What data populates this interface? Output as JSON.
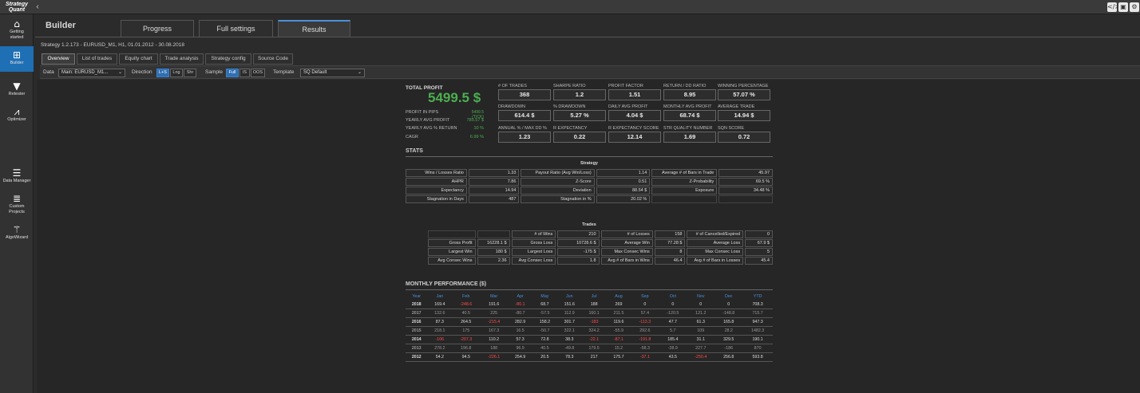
{
  "app": {
    "logo_line1": "Strategy",
    "logo_line2": "Quant",
    "collapse_icon": "chevron-left-icon"
  },
  "top_icons": [
    "code-icon",
    "window-icon",
    "settings-icon"
  ],
  "sidebar": {
    "items": [
      {
        "label1": "Getting",
        "label2": "started",
        "icon": "home-icon"
      },
      {
        "label1": "Builder",
        "label2": "",
        "icon": "plus-box-icon"
      },
      {
        "label1": "Retester",
        "label2": "",
        "icon": "filter-icon"
      },
      {
        "label1": "Optimizer",
        "label2": "",
        "icon": "chart-icon"
      },
      {
        "label1": "Data Manager",
        "label2": "",
        "icon": "database-icon"
      },
      {
        "label1": "Custom",
        "label2": "Projects",
        "icon": "layers-icon"
      },
      {
        "label1": "AlgoWizard",
        "label2": "",
        "icon": "wand-icon"
      }
    ]
  },
  "header": {
    "title": "Builder",
    "tabs": [
      "Progress",
      "Full settings",
      "Results"
    ]
  },
  "strategy_info": "Strategy 1.2.173 - EURUSD_M1, H1, 01.01.2012 - 30.08.2018",
  "subtabs": [
    "Overview",
    "List of trades",
    "Equity chart",
    "Trade analysis",
    "Strategy config",
    "Source Code"
  ],
  "toolbar": {
    "data_label": "Data",
    "data_value": "Main: EURUSD_M1...",
    "direction_label": "Direction",
    "direction_opts": [
      "L+S",
      "Lng",
      "Shr"
    ],
    "sample_label": "Sample",
    "sample_opts": [
      "Full",
      "IS",
      "OOS"
    ],
    "template_label": "Template",
    "template_value": "SQ Default"
  },
  "summary": {
    "total_profit_label": "TOTAL PROFIT",
    "total_profit": "5499.5 $",
    "rows": [
      {
        "k": "PROFIT IN PIPS",
        "v": "5499.5 (TICK)"
      },
      {
        "k": "YEARLY AVG PROFIT",
        "v": "785.57 $"
      },
      {
        "k": "YEARLY AVG % RETURN",
        "v": "10 %"
      },
      {
        "k": "CAGR",
        "v": "6.99 %"
      }
    ]
  },
  "metrics": [
    {
      "k": "# OF TRADES",
      "v": "368"
    },
    {
      "k": "SHARPE RATIO",
      "v": "1.2"
    },
    {
      "k": "PROFIT FACTOR",
      "v": "1.51"
    },
    {
      "k": "RETURN / DD RATIO",
      "v": "8.95"
    },
    {
      "k": "WINNING PERCENTAGE",
      "v": "57.07 %"
    },
    {
      "k": "DRAWDOWN",
      "v": "614.4 $"
    },
    {
      "k": "% DRAWDOWN",
      "v": "5.27 %"
    },
    {
      "k": "DAILY AVG PROFIT",
      "v": "4.04 $"
    },
    {
      "k": "MONTHLY AVG PROFIT",
      "v": "68.74 $"
    },
    {
      "k": "AVERAGE TRADE",
      "v": "14.94 $"
    },
    {
      "k": "ANNUAL % / MAX DD %",
      "v": "1.23"
    },
    {
      "k": "R EXPECTANCY",
      "v": "0.22"
    },
    {
      "k": "R EXPECTANCY SCORE",
      "v": "12.14"
    },
    {
      "k": "STR QUALITY NUMBER",
      "v": "1.69"
    },
    {
      "k": "SQN SCORE",
      "v": "0.72"
    }
  ],
  "stats": {
    "title": "STATS",
    "subtitle": "Strategy",
    "rows": [
      [
        "Wins / Losses Ratio",
        "1.33",
        "Payout Ratio (Avg Win/Loss)",
        "1.14",
        "Average # of Bars in Trade",
        "45.97"
      ],
      [
        "AHPR",
        "7.86",
        "Z-Score",
        "0.51",
        "Z-Probability",
        "69.5 %"
      ],
      [
        "Expectancy",
        "14.94",
        "Deviation",
        "88.54 $",
        "Exposure",
        "34.48 %"
      ],
      [
        "Stagnation in Days",
        "487",
        "Stagnation in %",
        "20.02 %",
        "",
        ""
      ]
    ]
  },
  "trades": {
    "title": "Trades",
    "header": [
      "",
      "",
      "# of Wins",
      "210",
      "# of Losses",
      "158",
      "# of Cancelled/Expired",
      "0"
    ],
    "rows": [
      [
        "Gross Profit",
        "16228.1 $",
        "Gross Loss",
        "10728.6 $",
        "Average Win",
        "77.28 $",
        "Average Loss",
        "67.9 $"
      ],
      [
        "Largest Win",
        "180 $",
        "Largest Loss",
        "-175 $",
        "Max Consec Wins",
        "8",
        "Max Consec Loss",
        "5"
      ],
      [
        "Avg Consec Wins",
        "2.36",
        "Avg Consec Loss",
        "1.8",
        "Avg # of Bars in Wins",
        "46.4",
        "Avg # of Bars in Losses",
        "45.4"
      ]
    ]
  },
  "monthly": {
    "title": "MONTHLY PERFORMANCE ($)",
    "columns": [
      "Year",
      "Jan",
      "Feb",
      "Mar",
      "Apr",
      "May",
      "Jun",
      "Jul",
      "Aug",
      "Sep",
      "Oct",
      "Nov",
      "Dec",
      "YTD"
    ],
    "rows": [
      [
        "2018",
        "169.4",
        "-248.6",
        "191.6",
        "-80.1",
        "68.7",
        "151.6",
        "188",
        "269",
        "0",
        "0",
        "0",
        "0",
        "708.3"
      ],
      [
        "2017",
        "132.6",
        "40.5",
        "225",
        "-80.7",
        "-57.5",
        "112.9",
        "160.1",
        "211.5",
        "57.4",
        "-120.5",
        "121.2",
        "-148.8",
        "715.7"
      ],
      [
        "2016",
        "87.3",
        "264.5",
        "-215.4",
        "282.9",
        "158.2",
        "301.7",
        "-183",
        "119.6",
        "-113.3",
        "47.7",
        "61.3",
        "165.8",
        "947.3"
      ],
      [
        "2015",
        "218.1",
        "175",
        "167.3",
        "16.5",
        "-50.7",
        "322.1",
        "324.2",
        "-55.9",
        "292.6",
        "5.7",
        "109",
        "28.2",
        "1482.3"
      ],
      [
        "2014",
        "-106",
        "-207.3",
        "110.2",
        "57.3",
        "72.8",
        "38.3",
        "-22.1",
        "-87.1",
        "-191.8",
        "185.4",
        "31.1",
        "329.5",
        "190.1"
      ],
      [
        "2013",
        "278.2",
        "196.8",
        "188",
        "96.9",
        "40.5",
        "-49.8",
        "179.5",
        "15.2",
        "-58.3",
        "-38.9",
        "227.7",
        "-186",
        "870"
      ],
      [
        "2012",
        "54.2",
        "94.5",
        "-226.1",
        "254.9",
        "20.5",
        "78.3",
        "217",
        "175.7",
        "-37.1",
        "43.5",
        "-250.4",
        "256.8",
        "593.8"
      ]
    ]
  },
  "colors": {
    "accent": "#1f6fb5",
    "positive": "#4caf50",
    "negative": "#ff5252",
    "month_header": "#4a90d9"
  }
}
